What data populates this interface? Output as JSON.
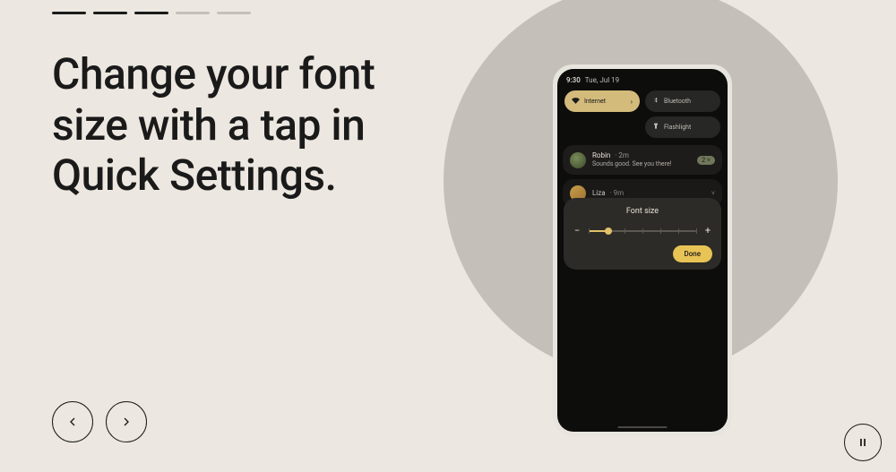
{
  "progress": {
    "total": 5,
    "active": 3
  },
  "heading_line1": "Change your font",
  "heading_line2": "size with a tap in",
  "heading_line3": "Quick Settings.",
  "phone": {
    "status": {
      "time": "9:30",
      "date": "Tue, Jul 19"
    },
    "qs": {
      "internet": "Internet",
      "bluetooth": "Bluetooth",
      "flashlight": "Flashlight"
    },
    "notifications": [
      {
        "name": "Robin",
        "time": "2m",
        "body": "Sounds good. See you there!",
        "badge": "2"
      },
      {
        "name": "Liza",
        "time": "9m",
        "body": ""
      }
    ],
    "dialog": {
      "title": "Font size",
      "minus": "−",
      "plus": "+",
      "done_label": "Done"
    }
  },
  "nav": {
    "prev_aria": "Previous",
    "next_aria": "Next",
    "pause_aria": "Pause"
  }
}
